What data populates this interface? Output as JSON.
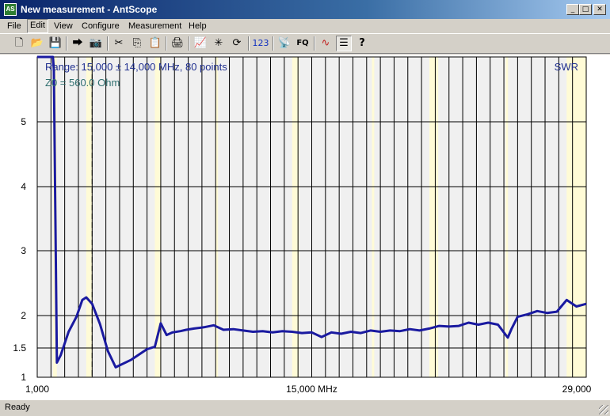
{
  "window": {
    "title": "New measurement - AntScope",
    "icon_label": "AS"
  },
  "menu": [
    "File",
    "Edit",
    "View",
    "Configure",
    "Measurement",
    "Help"
  ],
  "toolbar": [
    {
      "name": "new-icon",
      "glyph": "🗋"
    },
    {
      "name": "open-icon",
      "glyph": "📂"
    },
    {
      "name": "save-icon",
      "glyph": "💾"
    },
    {
      "name": "export-icon",
      "glyph": "⮕"
    },
    {
      "name": "camera-icon",
      "glyph": "📷"
    },
    {
      "name": "cut-icon",
      "glyph": "✂"
    },
    {
      "name": "copy-icon",
      "glyph": "⎘"
    },
    {
      "name": "paste-icon",
      "glyph": "📋"
    },
    {
      "name": "print-icon",
      "glyph": "🖨"
    },
    {
      "name": "chart-icon",
      "glyph": "📈"
    },
    {
      "name": "burst-icon",
      "glyph": "✳"
    },
    {
      "name": "refresh-icon",
      "glyph": "⟳"
    },
    {
      "name": "numbers-icon",
      "glyph": "123"
    },
    {
      "name": "antenna-icon",
      "glyph": "📡"
    },
    {
      "name": "fq-icon",
      "glyph": "FQ"
    },
    {
      "name": "waveform-icon",
      "glyph": "∿"
    },
    {
      "name": "list-icon",
      "glyph": "☰"
    },
    {
      "name": "help-icon",
      "glyph": "?"
    }
  ],
  "chart_data": {
    "type": "line",
    "range_text": "Range: 15,000 ± 14,000 MHz, 80 points",
    "z0_text": "Z0 = 560.0 Ohm",
    "series_label": "SWR",
    "xlabel": "",
    "ylabel": "",
    "xlim": [
      1.0,
      29.0
    ],
    "x_tick_labels": [
      "1,000",
      "15,000 MHz",
      "29,000"
    ],
    "y_ticks": [
      1,
      1.5,
      2,
      3,
      4,
      5
    ],
    "y_tick_labels": [
      "1",
      "1.5",
      "2",
      "3",
      "4",
      "5"
    ],
    "marker_x": 3.8,
    "band_highlights": [
      [
        1.8,
        2.0
      ],
      [
        3.5,
        3.8
      ],
      [
        7.0,
        7.3
      ],
      [
        10.1,
        10.15
      ],
      [
        14.0,
        14.35
      ],
      [
        18.068,
        18.168
      ],
      [
        21.0,
        21.45
      ],
      [
        24.89,
        24.99
      ],
      [
        28.0,
        29.0
      ]
    ],
    "colors": {
      "line": "#1a1aa0",
      "band": "#fffbd6",
      "grid": "#000000",
      "plot_bg": "#f0f0f0",
      "label": "#1f2f8f",
      "z0": "#2f6f6f"
    },
    "x": [
      1.0,
      1.8,
      1.85,
      2.0,
      2.2,
      2.6,
      3.0,
      3.3,
      3.5,
      3.8,
      4.2,
      4.6,
      5.0,
      5.8,
      6.6,
      7.0,
      7.3,
      7.6,
      7.9,
      8.3,
      8.6,
      9.0,
      9.5,
      10.0,
      10.5,
      11.0,
      11.5,
      12.0,
      12.5,
      13.0,
      13.5,
      14.0,
      14.5,
      15.0,
      15.5,
      16.0,
      16.5,
      17.0,
      17.5,
      18.0,
      18.5,
      19.0,
      19.5,
      20.0,
      20.5,
      21.0,
      21.5,
      22.0,
      22.5,
      23.0,
      23.5,
      24.0,
      24.5,
      25.0,
      25.2,
      25.5,
      26.0,
      26.5,
      27.0,
      27.5,
      28.0,
      28.5,
      29.0
    ],
    "y": [
      99,
      99,
      5.8,
      1.25,
      1.38,
      1.75,
      1.98,
      2.24,
      2.28,
      2.18,
      1.87,
      1.45,
      1.17,
      1.3,
      1.48,
      1.52,
      1.88,
      1.7,
      1.74,
      1.76,
      1.78,
      1.8,
      1.82,
      1.85,
      1.78,
      1.79,
      1.77,
      1.75,
      1.76,
      1.74,
      1.76,
      1.75,
      1.73,
      1.74,
      1.67,
      1.74,
      1.72,
      1.75,
      1.73,
      1.77,
      1.75,
      1.77,
      1.76,
      1.79,
      1.77,
      1.8,
      1.84,
      1.83,
      1.84,
      1.89,
      1.86,
      1.89,
      1.86,
      1.66,
      1.8,
      1.98,
      2.02,
      2.07,
      2.04,
      2.06,
      2.24,
      2.14,
      2.18
    ]
  },
  "status": {
    "text": "Ready"
  }
}
